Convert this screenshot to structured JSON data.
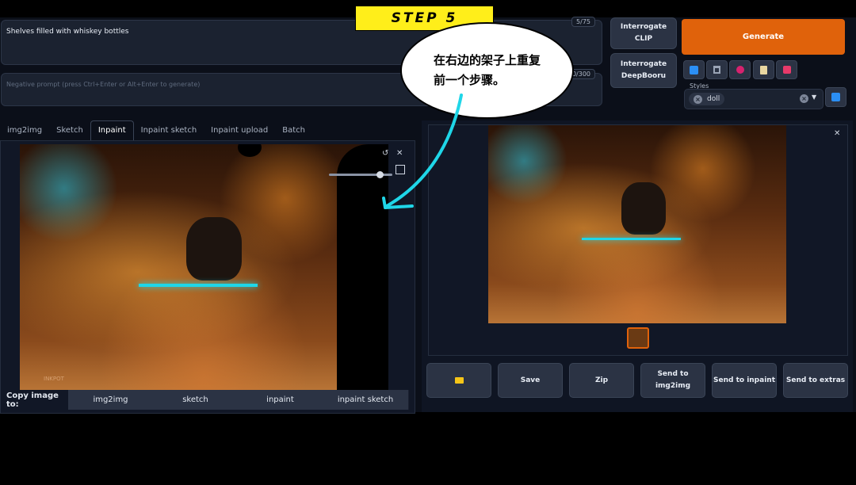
{
  "prompt": {
    "text": "Shelves filled with whiskey bottles",
    "token_count": "5/75",
    "negative_placeholder": "Negative prompt (press Ctrl+Enter or Alt+Enter to generate)",
    "negative_token_count": "0/300"
  },
  "interrogate": {
    "clip": "Interrogate\nCLIP",
    "deepbooru": "Interrogate\nDeepBooru"
  },
  "generate_label": "Generate",
  "tools": [
    {
      "name": "paste-icon",
      "color": "#2b8ff5"
    },
    {
      "name": "trash-icon",
      "color": "#9aa4b5"
    },
    {
      "name": "style-icon",
      "color": "#d7226e"
    },
    {
      "name": "clipboard-icon",
      "color": "#e8d6a0"
    },
    {
      "name": "save-icon",
      "color": "#e83a6a"
    }
  ],
  "styles": {
    "label": "Styles",
    "chip": "doll"
  },
  "tabs": [
    "img2img",
    "Sketch",
    "Inpaint",
    "Inpaint sketch",
    "Inpaint upload",
    "Batch"
  ],
  "active_tab": "Inpaint",
  "copy_to": {
    "label": "Copy image to:",
    "buttons": [
      "img2img",
      "sketch",
      "inpaint",
      "inpaint sketch"
    ]
  },
  "output_buttons": [
    "Save",
    "Zip",
    "Send to\nimg2img",
    "Send to inpaint",
    "Send to extras"
  ],
  "overlay": {
    "step": "STEP 5",
    "bubble": "在右边的架子上重复\n前一个步骤。",
    "accent": "#1fd6e8"
  },
  "watermark": "INKPOT"
}
